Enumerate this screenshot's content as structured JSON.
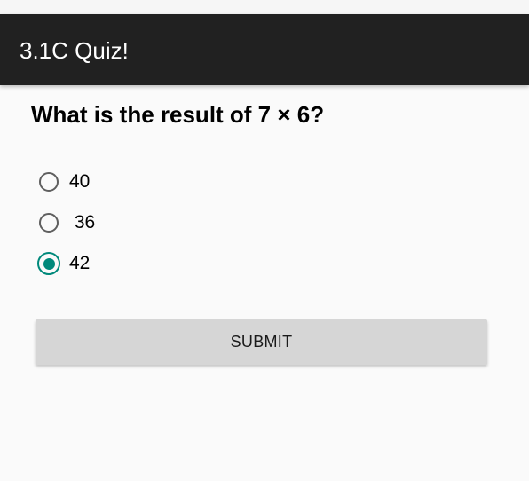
{
  "app_bar": {
    "title": "3.1C Quiz!"
  },
  "quiz": {
    "question": "What is the result of 7 × 6?",
    "options": [
      {
        "label": "40",
        "selected": false
      },
      {
        "label": " 36",
        "selected": false
      },
      {
        "label": "42",
        "selected": true
      }
    ],
    "submit_label": "SUBMIT"
  },
  "colors": {
    "app_bar_background": "#212121",
    "accent": "#00897b",
    "page_background": "#fafafa",
    "button_background": "#d6d6d6"
  }
}
